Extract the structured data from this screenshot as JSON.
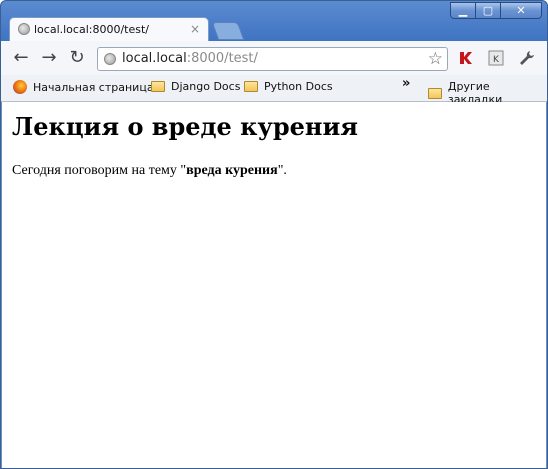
{
  "window": {
    "minimize_icon": "minimize-icon",
    "maximize_icon": "maximize-icon",
    "close_icon": "close-icon"
  },
  "tab": {
    "title": "local.local:8000/test/",
    "close_label": "×"
  },
  "omnibox": {
    "url_host": "local.local",
    "url_rest": ":8000/test/"
  },
  "bookmarks": {
    "items": [
      {
        "label": "Начальная страница"
      },
      {
        "label": "Django Docs"
      },
      {
        "label": "Python Docs"
      }
    ],
    "overflow": "»",
    "other": "Другие закладки"
  },
  "page": {
    "heading": "Лекция о вреде курения",
    "text_before": "Сегодня поговорим на тему \"",
    "text_bold": "вреда курения",
    "text_after": "\"."
  }
}
